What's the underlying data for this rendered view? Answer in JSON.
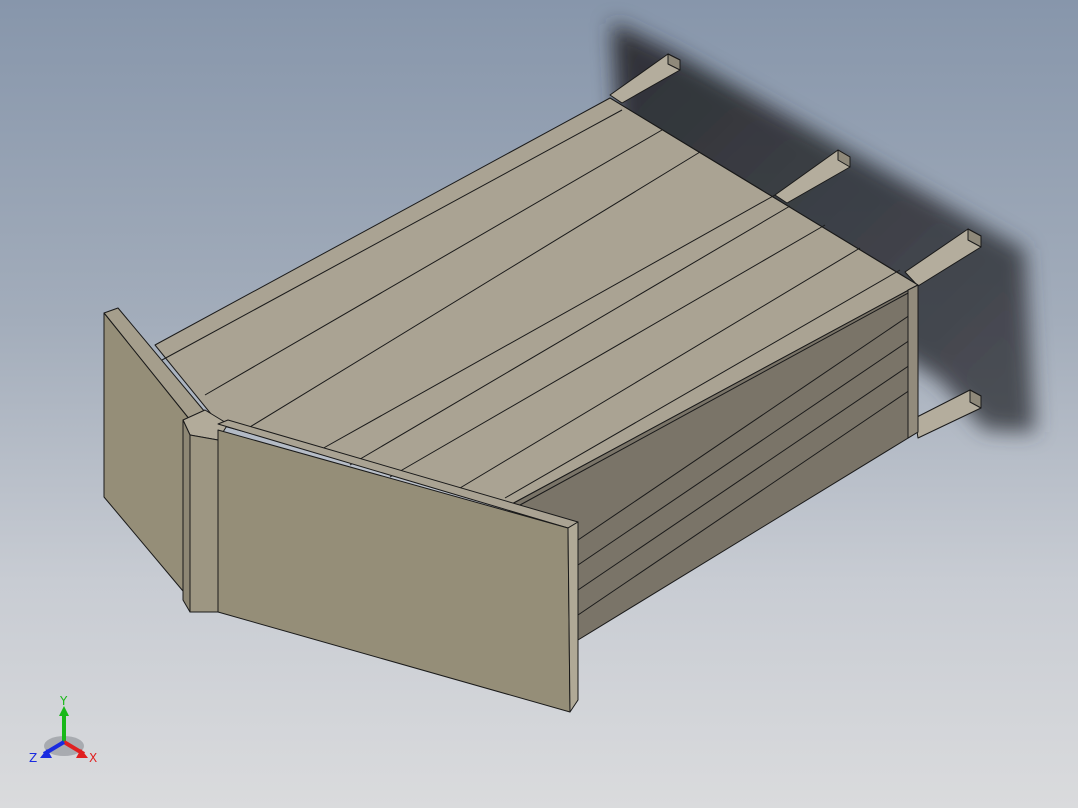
{
  "viewport": {
    "background_top": "#8796ab",
    "background_bottom": "#dadbdd"
  },
  "model": {
    "name": "",
    "face_color_top": "#aaa393",
    "face_color_front": "#958e78",
    "face_color_dark": "#7a7468",
    "edge_color": "#1a1a1a",
    "shadow_color": "#2a2c30"
  },
  "triad": {
    "x_label": "X",
    "y_label": "Y",
    "z_label": "Z",
    "x_color": "#e02020",
    "y_color": "#18b818",
    "z_color": "#1a2be0"
  }
}
